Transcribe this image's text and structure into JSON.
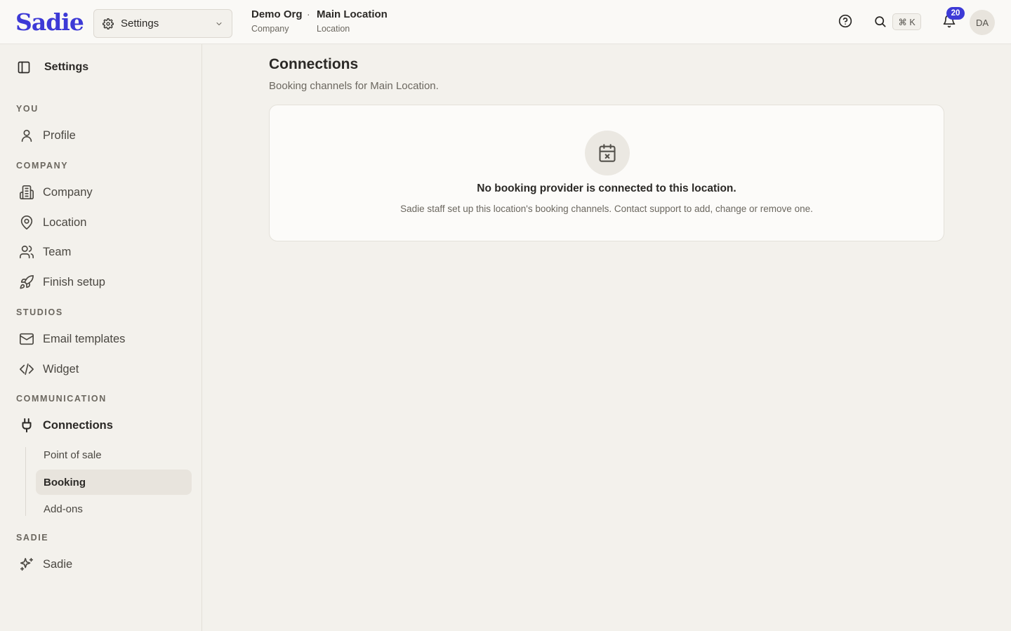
{
  "app": {
    "logo": "Sadie"
  },
  "topbar": {
    "workspace_select": {
      "label": "Settings",
      "icon": "gear-icon"
    },
    "breadcrumbs": [
      {
        "title": "Demo Org",
        "subtitle": "Company"
      },
      {
        "title": "Main Location",
        "subtitle": "Location"
      }
    ],
    "separator": "·",
    "shortcut": "⌘ K",
    "notification_count": "20",
    "avatar_initials": "DA"
  },
  "sidebar": {
    "title": "Settings",
    "sections": {
      "you": "YOU",
      "company": "COMPANY",
      "studios": "STUDIOS",
      "communication": "COMMUNICATION",
      "sadie": "SADIE"
    },
    "items": {
      "profile": "Profile",
      "company": "Company",
      "location": "Location",
      "team": "Team",
      "finish_setup": "Finish setup",
      "email_templates": "Email templates",
      "widget": "Widget",
      "connections": "Connections",
      "sadie": "Sadie"
    },
    "sub_items": {
      "point_of_sale": "Point of sale",
      "booking": "Booking",
      "add_ons": "Add-ons"
    }
  },
  "main": {
    "title": "Connections",
    "subtitle": "Booking channels for Main Location.",
    "empty_state": {
      "title": "No booking provider is connected to this location.",
      "message": "Sadie staff set up this location's booking channels. Contact support to add, change or remove one."
    }
  },
  "colors": {
    "accent": "#3d3ad6",
    "background": "#f3f1ec",
    "card": "#fcfbf9"
  }
}
